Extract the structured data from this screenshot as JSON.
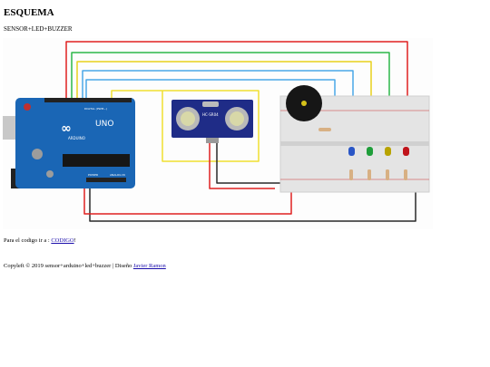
{
  "page": {
    "title": "ESQUEMA",
    "subtitle": "SENSOR+LED+BUZZER"
  },
  "diagram": {
    "arduino_logo": "∞",
    "arduino_uno": "UNO",
    "arduino_brand": "ARDUINO",
    "sensor_model": "HC-SR04",
    "arduino_label_power": "POWER",
    "arduino_label_analog": "ANALOG IN",
    "arduino_label_digital": "DIGITAL (PWM~)",
    "led_colors": [
      "#2a56c6",
      "#1f9e3a",
      "#b8a300",
      "#c0141b"
    ],
    "wire_colors": [
      "#e02020",
      "#2db84a",
      "#e8d21d",
      "#4aa8e8",
      "#2a2a2a",
      "#f0e030"
    ]
  },
  "codigo": {
    "prefix": "Para el codigo ir a :",
    "link": "CODIGO",
    "suffix": "!"
  },
  "footer": {
    "text": "Copyleft © 2019 sensor+arduino+led+buzzer | Diseño",
    "author": "Javier Ramon"
  }
}
